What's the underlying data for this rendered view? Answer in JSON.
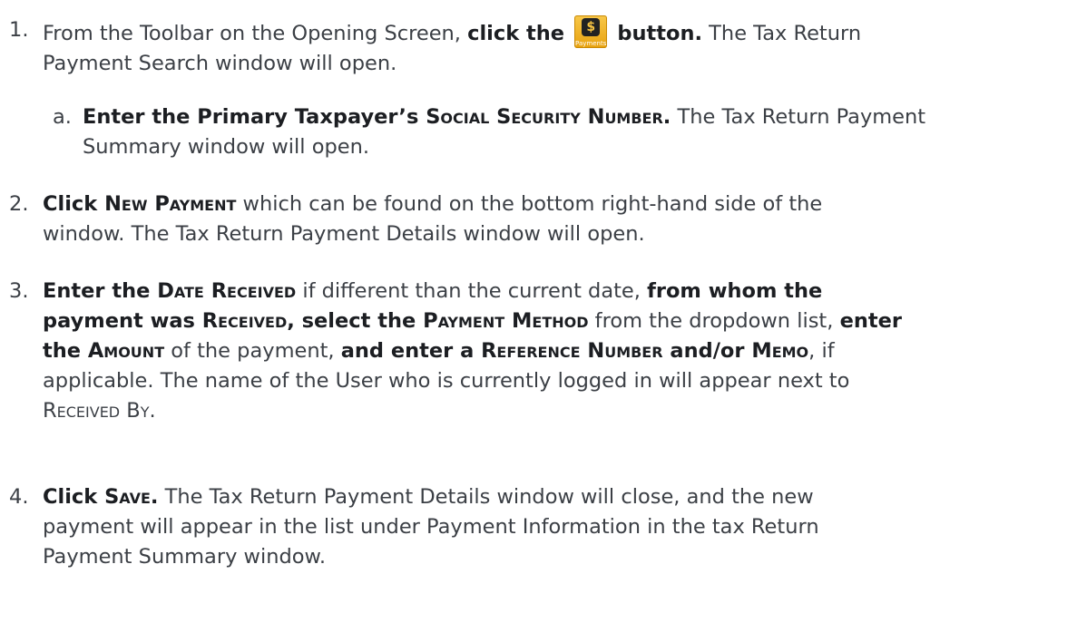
{
  "steps": [
    {
      "num": "1.",
      "line1_pre": "From the Toolbar on the Opening Screen, ",
      "line1_bold": "click the",
      "line1_bold2": "button.",
      "line1_post": " The Tax Return",
      "line2": "Payment Search window will open.",
      "icon": {
        "name": "payments-icon",
        "label": "Payments"
      }
    },
    {
      "num": "a.",
      "bold_a": "Enter the Primary Taxpayer’s ",
      "bold_a_sc": "Social Security Number.",
      "post_a": " The Tax Return Payment",
      "line2": "Summary window will open."
    },
    {
      "num": "2.",
      "bold_a": "Click ",
      "bold_a_sc": "New Payment",
      "post_a": " which can be found on the bottom right-hand side of the",
      "line2": "window. The Tax Return Payment Details window will open."
    },
    {
      "num": "3.",
      "l1_b1": "Enter the ",
      "l1_sc1": "Date Received",
      "l1_t1": " if different than the current date, ",
      "l1_b2": "from whom the",
      "l2_b1": "payment was ",
      "l2_sc1": "Received",
      "l2_b2": ", select the ",
      "l2_sc2": "Payment Method",
      "l2_t1": " from the dropdown list, ",
      "l2_b3": "enter",
      "l3_b1": "the ",
      "l3_sc1": "Amount",
      "l3_t1": " of the payment, ",
      "l3_b2": "and enter a ",
      "l3_sc2": "Reference Number",
      "l3_b3": " and/or ",
      "l3_sc3": "Memo",
      "l3_t2": ", if",
      "l4": "applicable. The name of the User who is currently logged in will appear next to",
      "l5_sc": "Received By",
      "l5_t": "."
    },
    {
      "num": "4.",
      "bold_a": "Click ",
      "bold_a_sc": "Save.",
      "post_a": " The Tax Return Payment Details window will close, and the new",
      "line2": "payment will appear in the list under Payment Information in the tax Return",
      "line3": "Payment Summary window."
    }
  ]
}
